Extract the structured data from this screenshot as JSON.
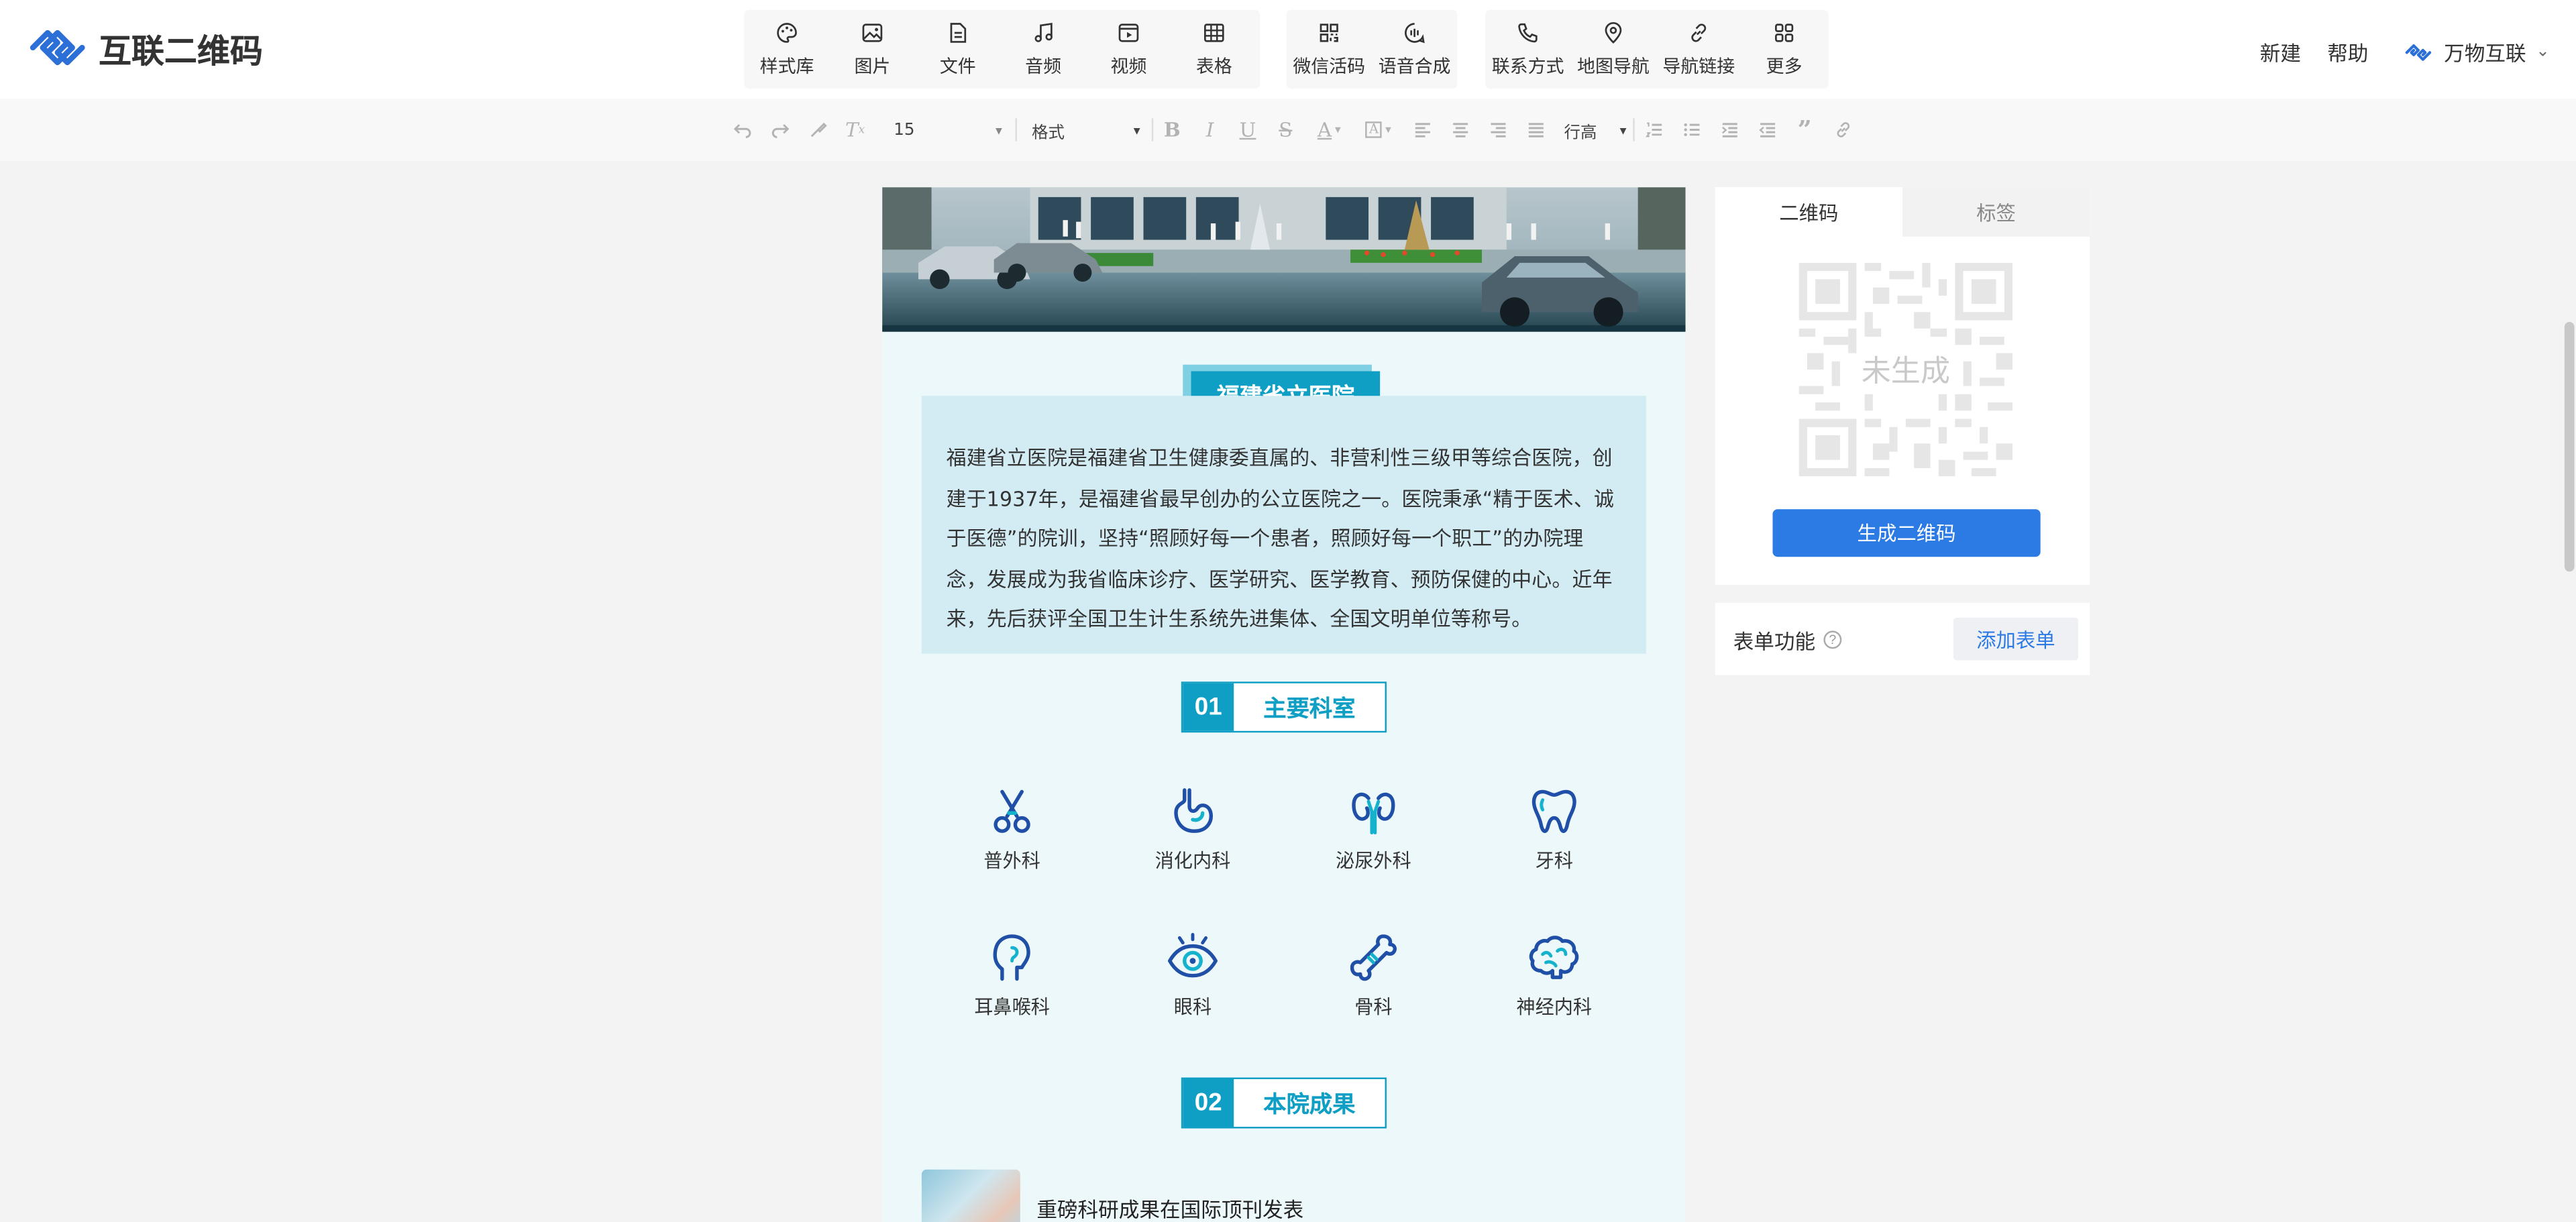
{
  "app": {
    "name": "互联二维码"
  },
  "toolbar": {
    "group1": [
      {
        "label": "样式库",
        "icon": "palette-icon"
      },
      {
        "label": "图片",
        "icon": "image-icon"
      },
      {
        "label": "文件",
        "icon": "file-icon"
      },
      {
        "label": "音频",
        "icon": "music-icon"
      },
      {
        "label": "视频",
        "icon": "video-icon"
      },
      {
        "label": "表格",
        "icon": "table-icon"
      }
    ],
    "group2": [
      {
        "label": "微信活码",
        "icon": "qr-grid-icon"
      },
      {
        "label": "语音合成",
        "icon": "voice-icon"
      }
    ],
    "group3": [
      {
        "label": "联系方式",
        "icon": "phone-icon"
      },
      {
        "label": "地图导航",
        "icon": "map-pin-icon"
      },
      {
        "label": "导航链接",
        "icon": "link-icon"
      },
      {
        "label": "更多",
        "icon": "more-grid-icon"
      }
    ]
  },
  "header_right": {
    "new_label": "新建",
    "help_label": "帮助",
    "brand_label": "万物互联"
  },
  "format_bar": {
    "font_size": "15",
    "format_select": "格式",
    "line_height": "行高"
  },
  "document": {
    "title": "福建省立医院",
    "intro": "福建省立医院是福建省卫生健康委直属的、非营利性三级甲等综合医院，创建于1937年，是福建省最早创办的公立医院之一。医院秉承“精于医术、诚于医德”的院训，坚持“照顾好每一个患者，照顾好每一个职工”的办院理念，发展成为我省临床诊疗、医学研究、医学教育、预防保健的中心。近年来，先后获评全国卫生计生系统先进集体、全国文明单位等称号。",
    "section1": {
      "num": "01",
      "label": "主要科室"
    },
    "departments": [
      {
        "label": "普外科",
        "icon": "scissors-icon"
      },
      {
        "label": "消化内科",
        "icon": "stomach-icon"
      },
      {
        "label": "泌尿外科",
        "icon": "kidney-icon"
      },
      {
        "label": "牙科",
        "icon": "tooth-icon"
      },
      {
        "label": "耳鼻喉科",
        "icon": "head-ear-icon"
      },
      {
        "label": "眼科",
        "icon": "eye-icon"
      },
      {
        "label": "骨科",
        "icon": "bone-icon"
      },
      {
        "label": "神经内科",
        "icon": "brain-icon"
      }
    ],
    "section2": {
      "num": "02",
      "label": "本院成果"
    },
    "achievement": "重磅科研成果在国际顶刊发表"
  },
  "right_panel": {
    "tab_qr": "二维码",
    "tab_tag": "标签",
    "qr_placeholder": "未生成",
    "generate_button": "生成二维码",
    "form_label": "表单功能",
    "add_form_button": "添加表单"
  },
  "colors": {
    "accent": "#0f9fc4",
    "primary_button": "#2c7be5",
    "logo_blue": "#2c6fd6"
  }
}
